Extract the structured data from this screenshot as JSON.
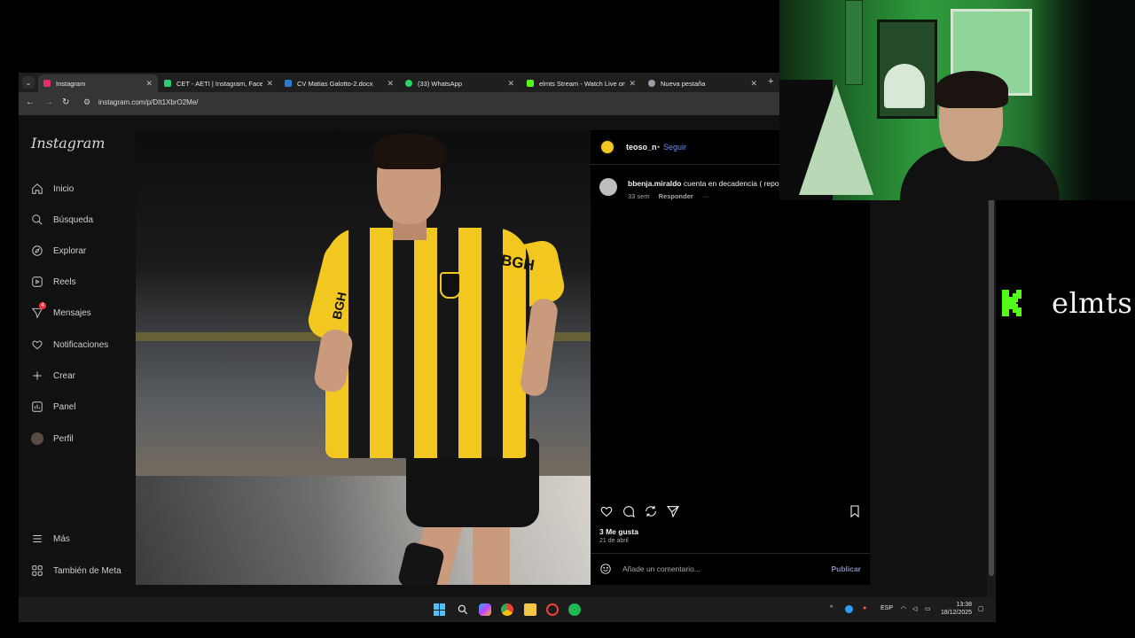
{
  "browser": {
    "tabs": [
      {
        "label": "Instagram",
        "active": true,
        "favicon_color": "#e1306c"
      },
      {
        "label": "CET - AETI | Instagram, Faceboo",
        "active": false,
        "favicon_color": "#2ecc71"
      },
      {
        "label": "CV Matias Galotto-2.docx",
        "active": false,
        "favicon_color": "#2b7cd3"
      },
      {
        "label": "(33) WhatsApp",
        "active": false,
        "favicon_color": "#25d366"
      },
      {
        "label": "elmts Stream - Watch Live on K",
        "active": false,
        "favicon_color": "#53fc18"
      },
      {
        "label": "Nueva pestaña",
        "active": false,
        "favicon_color": "#9aa0a6"
      }
    ],
    "new_tab": "+",
    "url": "instagram.com/p/DIt1XbrO2Me/"
  },
  "instagram": {
    "logo": "Instagram",
    "nav": [
      {
        "label": "Inicio",
        "icon": "home-icon"
      },
      {
        "label": "Búsqueda",
        "icon": "search-icon"
      },
      {
        "label": "Explorar",
        "icon": "compass-icon"
      },
      {
        "label": "Reels",
        "icon": "reels-icon"
      },
      {
        "label": "Mensajes",
        "icon": "messages-icon",
        "badge": "4"
      },
      {
        "label": "Notificaciones",
        "icon": "heart-icon"
      },
      {
        "label": "Crear",
        "icon": "plus-icon"
      },
      {
        "label": "Panel",
        "icon": "dashboard-icon"
      },
      {
        "label": "Perfil",
        "icon": "profile-avatar-icon"
      }
    ],
    "nav_bottom": [
      {
        "label": "Más",
        "icon": "menu-icon"
      },
      {
        "label": "También de Meta",
        "icon": "meta-apps-icon"
      }
    ],
    "post": {
      "image_sponsor": "BGH",
      "author": "teoso_n",
      "separator": "•",
      "follow": "Seguir",
      "comment": {
        "user": "bbenja.miraldo",
        "text": "cuenta en decadencia ( repo",
        "time": "33 sem",
        "reply": "Responder",
        "more": "···"
      },
      "likes": "3 Me gusta",
      "date": "21 de abril",
      "comment_placeholder": "Añade un comentario...",
      "publish": "Publicar"
    }
  },
  "taskbar": {
    "language": "ESP",
    "time": "13:38",
    "date": "18/12/2025",
    "tray_chevron": "^"
  },
  "overlay": {
    "brand": "elmts",
    "brand_color": "#53fc18"
  }
}
